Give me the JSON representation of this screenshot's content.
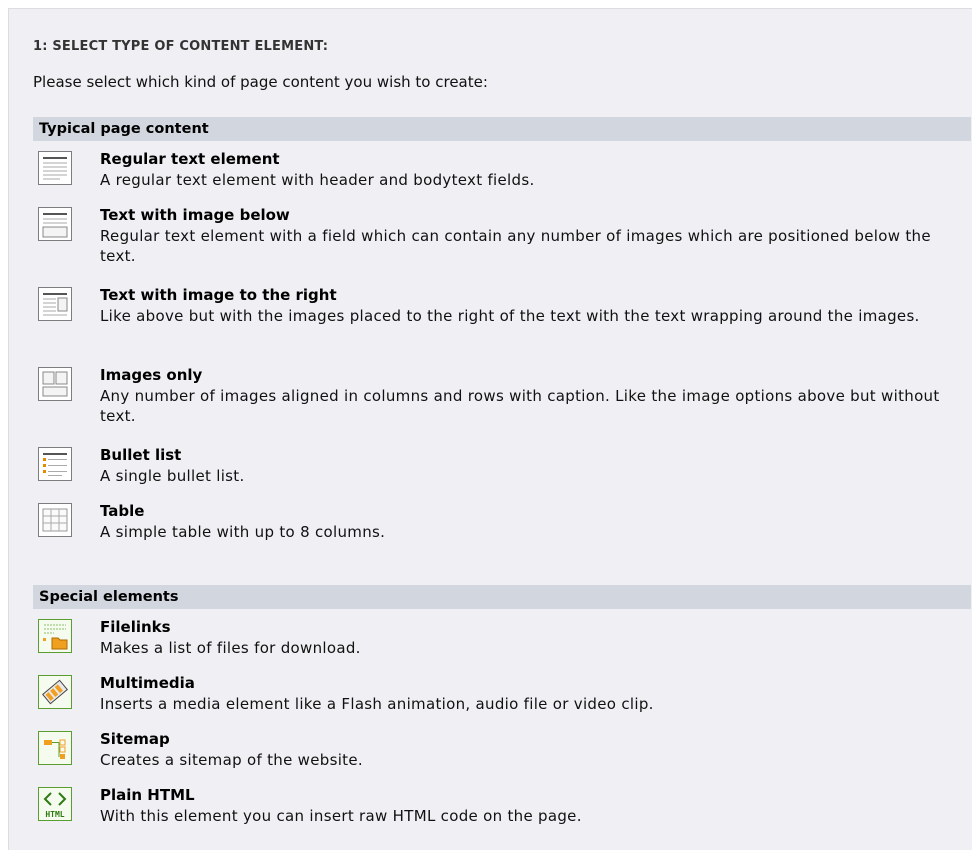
{
  "step_title": "1: SELECT TYPE OF CONTENT ELEMENT:",
  "intro": "Please select which kind of page content you wish to create:",
  "sections": [
    {
      "header": "Typical page content",
      "items": [
        {
          "title": "Regular text element",
          "desc": "A regular text element with header and bodytext fields.",
          "icon": "text-element-icon"
        },
        {
          "title": "Text with image below",
          "desc": "Regular text element with a field which can contain any number of images which are positioned below the text.",
          "icon": "text-image-below-icon"
        },
        {
          "title": "Text with image to the right",
          "desc": "Like above but with the images placed to the right of the text with the text wrapping around the images.",
          "icon": "text-image-right-icon"
        },
        {
          "title": "Images only",
          "desc": "Any number of images aligned in columns and rows with caption. Like the image options above but without text.",
          "icon": "images-only-icon"
        },
        {
          "title": "Bullet list",
          "desc": "A single bullet list.",
          "icon": "bullet-list-icon"
        },
        {
          "title": "Table",
          "desc": "A simple table with up to 8 columns.",
          "icon": "table-icon"
        }
      ]
    },
    {
      "header": "Special elements",
      "items": [
        {
          "title": "Filelinks",
          "desc": "Makes a list of files for download.",
          "icon": "filelinks-icon"
        },
        {
          "title": "Multimedia",
          "desc": "Inserts a media element like a Flash animation, audio file or video clip.",
          "icon": "multimedia-icon"
        },
        {
          "title": "Sitemap",
          "desc": "Creates a sitemap of the website.",
          "icon": "sitemap-icon"
        },
        {
          "title": "Plain HTML",
          "desc": "With this element you can insert raw HTML code on the page.",
          "icon": "plain-html-icon",
          "icon_text": "HTML"
        }
      ]
    }
  ],
  "colors": {
    "panel_bg": "#f0f0f4",
    "header_bg": "#d2d6de",
    "icon_green": "#5a9e2f",
    "icon_orange": "#f0a020"
  }
}
